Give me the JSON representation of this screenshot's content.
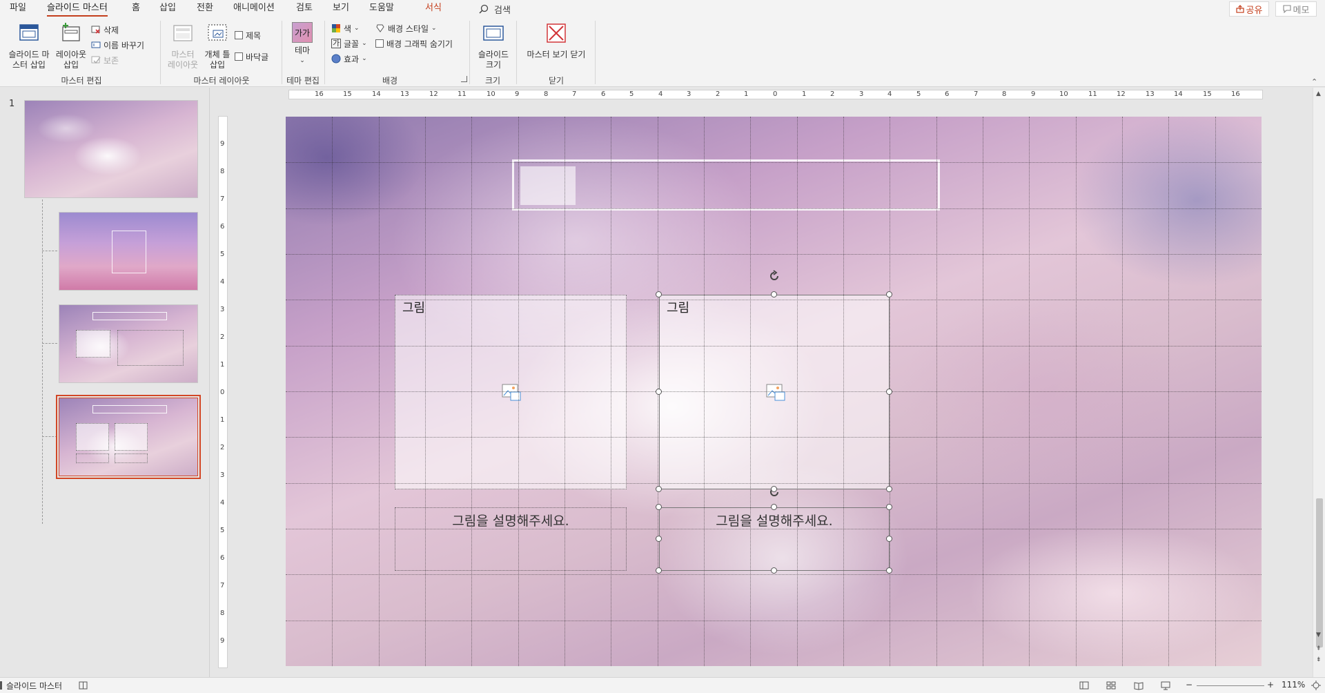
{
  "tabs": {
    "file": "파일",
    "slide_master": "슬라이드 마스터",
    "home": "홈",
    "insert": "삽입",
    "transitions": "전환",
    "animations": "애니메이션",
    "review": "검토",
    "view": "보기",
    "help": "도움말",
    "format": "서식",
    "search": "검색"
  },
  "header_buttons": {
    "share": "공유",
    "memo": "메모"
  },
  "ribbon": {
    "edit_master": {
      "label": "마스터 편집",
      "insert_slide_master_1": "슬라이드 마",
      "insert_slide_master_2": "스터 삽입",
      "insert_layout_1": "레이아웃",
      "insert_layout_2": "삽입",
      "delete": "삭제",
      "rename": "이름 바꾸기",
      "preserve": "보존"
    },
    "master_layout": {
      "label": "마스터 레이아웃",
      "master_layout_1": "마스터",
      "master_layout_2": "레이아웃",
      "insert_placeholder_1": "개체 틀",
      "insert_placeholder_2": "삽입",
      "title": "제목",
      "footers": "바닥글"
    },
    "edit_theme": {
      "label": "테마 편집",
      "themes": "테마",
      "theme_preview": "가가"
    },
    "background": {
      "label": "배경",
      "colors": "색",
      "fonts": "글꼴",
      "effects": "효과",
      "background_styles": "배경 스타일",
      "hide_background_graphics": "배경 그래픽 숨기기",
      "font_icon": "가"
    },
    "size": {
      "label": "크기",
      "slide_size_1": "슬라이드",
      "slide_size_2": "크기"
    },
    "close": {
      "label": "닫기",
      "close_master_view": "마스터 보기 닫기"
    }
  },
  "thumbnails": {
    "master_number": "1"
  },
  "rulers": {
    "horizontal": [
      "16",
      "15",
      "14",
      "13",
      "12",
      "11",
      "10",
      "9",
      "8",
      "7",
      "6",
      "5",
      "4",
      "3",
      "2",
      "1",
      "0",
      "1",
      "2",
      "3",
      "4",
      "5",
      "6",
      "7",
      "8",
      "9",
      "10",
      "11",
      "12",
      "13",
      "14",
      "15",
      "16"
    ],
    "vertical": [
      "9",
      "8",
      "7",
      "6",
      "5",
      "4",
      "3",
      "2",
      "1",
      "0",
      "1",
      "2",
      "3",
      "4",
      "5",
      "6",
      "7",
      "8",
      "9"
    ]
  },
  "slide": {
    "picture_placeholder_left": "그림",
    "picture_placeholder_right": "그림",
    "caption_left": "그림을 설명해주세요.",
    "caption_right": "그림을 설명해주세요."
  },
  "statusbar": {
    "view_name": "슬라이드 마스터",
    "zoom": "111%",
    "zoom_minus": "−",
    "zoom_plus": "+"
  },
  "colors": {
    "accent": "#c43e1c",
    "selection": "#d24726"
  }
}
